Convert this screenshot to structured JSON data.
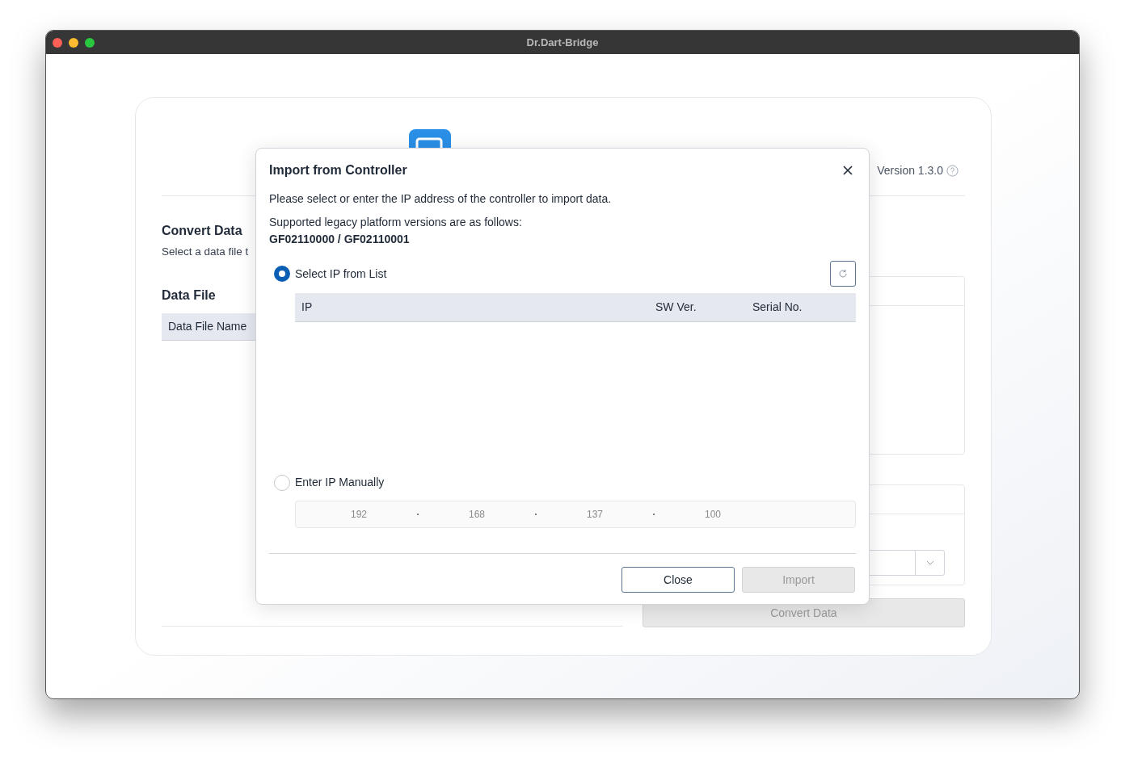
{
  "window": {
    "title": "Dr.Dart-Bridge"
  },
  "header": {
    "version": "Version 1.3.0"
  },
  "convert": {
    "title": "Convert Data",
    "subtitle": "Select a data file t"
  },
  "data_file": {
    "title": "Data File",
    "columns": [
      "Data File Name"
    ]
  },
  "convert_button": {
    "label": "Convert Data",
    "disabled": true
  },
  "dialog": {
    "title": "Import from Controller",
    "description": "Please select or enter the IP address of the controller to import data.",
    "versions_intro": "Supported legacy platform versions are as follows:",
    "versions": "GF02110000 / GF02110001",
    "options": [
      {
        "label": "Select IP from List",
        "selected": true
      },
      {
        "label": "Enter IP Manually",
        "selected": false
      }
    ],
    "table": {
      "columns": [
        "IP",
        "SW Ver.",
        "Serial No."
      ]
    },
    "ip_input": {
      "disabled": true,
      "octets": [
        {
          "placeholder": "192"
        },
        {
          "placeholder": "168"
        },
        {
          "placeholder": "137"
        },
        {
          "placeholder": "100"
        }
      ]
    },
    "buttons": [
      {
        "label": "Close",
        "kind": "secondary",
        "disabled": false
      },
      {
        "label": "Import",
        "kind": "primary",
        "disabled": true
      }
    ]
  }
}
